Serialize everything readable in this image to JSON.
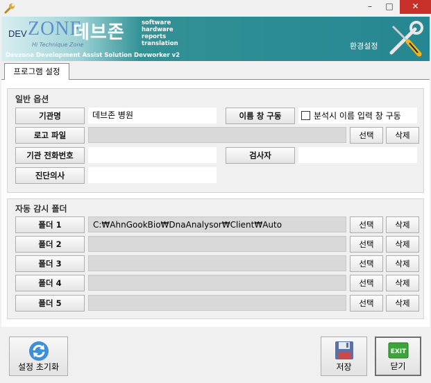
{
  "window": {
    "minimize": "–",
    "maximize": "□",
    "close": "✕"
  },
  "banner": {
    "logo_dev": "DEV",
    "logo_zone": "ZONE",
    "logo_tagline": "Hi Technique Zone",
    "logo_korean": "데브존",
    "logo_words": [
      "software",
      "hardware",
      "reports",
      "translation"
    ],
    "subtitle": "Devzone Development Assist Solution Devworker v2",
    "settings_label": "환경설정"
  },
  "tab": {
    "label": "프로그램 설정"
  },
  "general": {
    "title": "일반 옵션",
    "institution_label": "기관명",
    "institution_value": "데브존 병원",
    "name_window_button": "이름 창 구동",
    "name_window_checkbox_label": "분석시 이름 입력 창 구동",
    "name_window_checked": false,
    "logo_label": "로고 파일",
    "logo_value": "",
    "select": "선택",
    "delete": "삭제",
    "phone_label": "기관 전화번호",
    "phone_value": "",
    "inspector_label": "검사자",
    "inspector_value": "",
    "doctor_label": "진단의사",
    "doctor_value": ""
  },
  "monitor": {
    "title": "자동 감시 폴더",
    "select": "선택",
    "delete": "삭제",
    "folders": [
      {
        "label": "폴더 1",
        "value": "C:₩AhnGookBio₩DnaAnalysor₩Client₩Auto"
      },
      {
        "label": "폴더 2",
        "value": ""
      },
      {
        "label": "폴더 3",
        "value": ""
      },
      {
        "label": "폴더 4",
        "value": ""
      },
      {
        "label": "폴더 5",
        "value": ""
      }
    ]
  },
  "footer": {
    "reset": "설정 초기화",
    "save": "저장",
    "exit_icon_text": "EXIT",
    "close": "닫기"
  },
  "colors": {
    "banner": "#2f8f94",
    "close_button": "#c7312a",
    "exit_green": "#3aa63a"
  }
}
